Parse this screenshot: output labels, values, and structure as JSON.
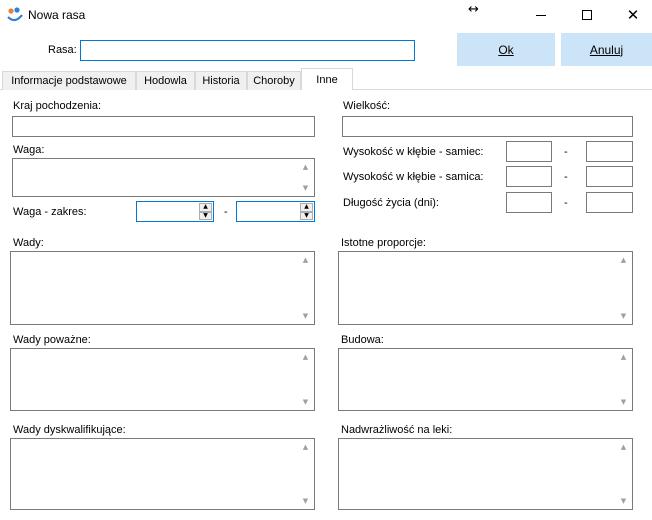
{
  "window": {
    "title": "Nowa rasa",
    "icon": "app-logo-icon",
    "resize_cursor_glyph": "↔"
  },
  "header": {
    "rasa_label": "Rasa:",
    "rasa_value": "",
    "ok_label": "Ok",
    "cancel_label": "Anuluj"
  },
  "tabs": [
    {
      "label": "Informacje podstawowe",
      "active": false
    },
    {
      "label": "Hodowla",
      "active": false
    },
    {
      "label": "Historia",
      "active": false
    },
    {
      "label": "Choroby",
      "active": false
    },
    {
      "label": "Inne",
      "active": true
    }
  ],
  "form": {
    "kraj_label": "Kraj pochodzenia:",
    "kraj_value": "",
    "wielkosc_label": "Wielkość:",
    "wielkosc_value": "",
    "waga_label": "Waga:",
    "waga_value": "",
    "waga_zakres_label": "Waga - zakres:",
    "waga_min": "",
    "waga_max": "",
    "wys_samiec_label": "Wysokość w kłębie - samiec:",
    "wys_samica_label": "Wysokość w kłębie - samica:",
    "dlugosc_label": "Długość życia (dni):",
    "range_separator": "-",
    "wady_label": "Wady:",
    "istotne_label": "Istotne proporcje:",
    "wady_powazne_label": "Wady poważne:",
    "budowa_label": "Budowa:",
    "wady_dysk_label": "Wady dyskwalifikujące:",
    "nadwrazliwosc_label": "Nadwrażliwość na leki:"
  },
  "colors": {
    "button_bg": "#cce4f7",
    "focus_border": "#0078d7",
    "tab_bg": "#f0f0f0"
  }
}
